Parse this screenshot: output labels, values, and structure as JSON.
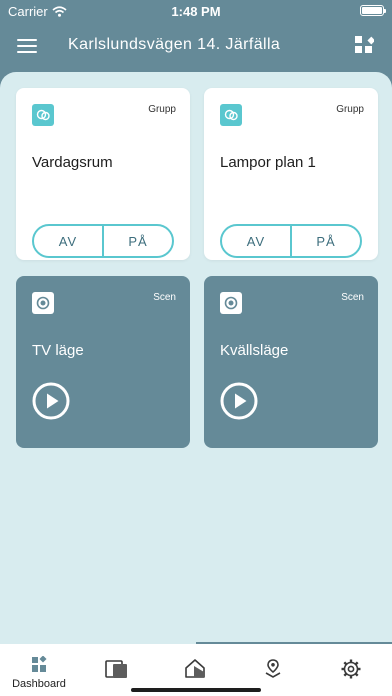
{
  "status_bar": {
    "carrier": "Carrier",
    "time": "1:48 PM"
  },
  "header": {
    "title": "Karlslundsvägen 14. Järfälla"
  },
  "cards": [
    {
      "type_label": "Grupp",
      "name": "Vardagsrum",
      "off_label": "AV",
      "on_label": "PÅ"
    },
    {
      "type_label": "Grupp",
      "name": "Lampor plan 1",
      "off_label": "AV",
      "on_label": "PÅ"
    },
    {
      "type_label": "Scen",
      "name": "TV läge"
    },
    {
      "type_label": "Scen",
      "name": "Kvällsläge"
    }
  ],
  "tabbar": {
    "dashboard_label": "Dashboard",
    "active_tab": "Dashboard"
  },
  "colors": {
    "teal": "#5ac7cf",
    "slate": "#658a98",
    "background": "#d8ecef"
  }
}
